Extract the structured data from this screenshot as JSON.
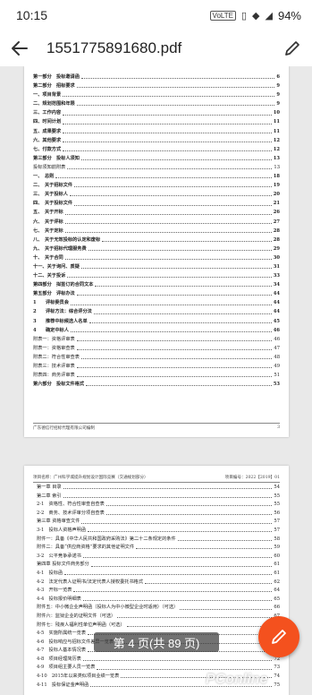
{
  "status": {
    "time": "10:15",
    "network": "VoLTE",
    "battery": "94%"
  },
  "appbar": {
    "title": "1551775891680.pdf"
  },
  "page1": {
    "toc": [
      {
        "t": "第一部分　投标邀请函",
        "p": "6",
        "bold": true
      },
      {
        "t": "第二部分　招标要求",
        "p": "9",
        "bold": true
      },
      {
        "t": "一、项目背景",
        "p": "9",
        "bold": true
      },
      {
        "t": "二、规划范围和年限",
        "p": "9",
        "bold": true
      },
      {
        "t": "三、工作内容",
        "p": "10",
        "bold": true
      },
      {
        "t": "四、时间计划",
        "p": "11",
        "bold": true
      },
      {
        "t": "五、成果要求",
        "p": "11",
        "bold": true
      },
      {
        "t": "六、其他要求",
        "p": "12",
        "bold": true
      },
      {
        "t": "七、付款方式",
        "p": "12",
        "bold": true
      },
      {
        "t": "第三部分　投标人须知",
        "p": "13",
        "bold": true
      },
      {
        "t": "投标须知前附表",
        "p": "13",
        "bold": false
      },
      {
        "t": "一、　总则",
        "p": "18",
        "bold": true
      },
      {
        "t": "二、　关于招标文件",
        "p": "19",
        "bold": true
      },
      {
        "t": "三、　关于投标人",
        "p": "20",
        "bold": true
      },
      {
        "t": "四、　关于投标文件",
        "p": "21",
        "bold": true
      },
      {
        "t": "五、　关于开标",
        "p": "26",
        "bold": true
      },
      {
        "t": "六、　关于评标",
        "p": "27",
        "bold": true
      },
      {
        "t": "七、　关于定标",
        "p": "28",
        "bold": true
      },
      {
        "t": "八、　关于无效投标的认定和废标",
        "p": "28",
        "bold": true
      },
      {
        "t": "九、　关于招标代理服务费",
        "p": "29",
        "bold": true
      },
      {
        "t": "十、　关于合同",
        "p": "30",
        "bold": true
      },
      {
        "t": "十一、关于询问、质疑",
        "p": "31",
        "bold": true
      },
      {
        "t": "十二、关于投诉",
        "p": "33",
        "bold": true
      },
      {
        "t": "第四部分　拟签订的合同文本",
        "p": "34",
        "bold": true
      },
      {
        "t": "第五部分　评标办法",
        "p": "44",
        "bold": true
      },
      {
        "t": "1　　评标委员会",
        "p": "44",
        "bold": true
      },
      {
        "t": "2　　评标方法：综合评分法",
        "p": "44",
        "bold": true
      },
      {
        "t": "3　　推荐中标候选人名单",
        "p": "45",
        "bold": true
      },
      {
        "t": "4　　确定中标人",
        "p": "46",
        "bold": true
      },
      {
        "t": "附表一：资格评审表",
        "p": "46",
        "bold": false
      },
      {
        "t": "附表一：资格审查表",
        "p": "47",
        "bold": false
      },
      {
        "t": "附表二：符合性审查表",
        "p": "48",
        "bold": false
      },
      {
        "t": "附表三：技术评审表",
        "p": "49",
        "bold": false
      },
      {
        "t": "附表四：商务评审表",
        "p": "51",
        "bold": false
      },
      {
        "t": "第六部分　投标文件格式",
        "p": "53",
        "bold": true
      }
    ],
    "footer_left": "广东德信行招标代理有限公司编制",
    "footer_right": "3"
  },
  "page2": {
    "header_left": "项目名称：广州科学城提升规划设计国际竞赛（交通规划部分）",
    "header_right": "项目编号：2022【2019】01",
    "toc": [
      {
        "t": "第一章 目录",
        "p": "54"
      },
      {
        "t": "第二章 索引",
        "p": "55"
      },
      {
        "t": "2-1　资格性、符合性审查自查表",
        "p": "55"
      },
      {
        "t": "2-2　商务、技术评审分项自查表",
        "p": "56"
      },
      {
        "t": "第三章 资格审查文件",
        "p": "57"
      },
      {
        "t": "3-1　投标人资格声明函",
        "p": "57"
      },
      {
        "t": "附件一：具备《中华人民共和国政府采购法》第二十二条规定的条件",
        "p": "58"
      },
      {
        "t": "附件二：具备“供应商资格”要求的其他证明文件",
        "p": "59"
      },
      {
        "t": "3-2　公平竞争承诺书",
        "p": "60"
      },
      {
        "t": "第四章 投标文件商务部分",
        "p": "61"
      },
      {
        "t": "4-1　投标函",
        "p": "61"
      },
      {
        "t": "4-2　法定代表人证明书/法定代表人授权委托书格式",
        "p": "62"
      },
      {
        "t": "4-3　开标一览表",
        "p": "64"
      },
      {
        "t": "4-4　投标报价明细表",
        "p": "65"
      },
      {
        "t": "附件五：中小微企业声明函（投标人为中小微型企业时适用）（可选）",
        "p": "66"
      },
      {
        "t": "附件六：监狱企业的证明文件（可选）",
        "p": "67"
      },
      {
        "t": "附件七：残疾人福利性单位声明函（可选）",
        "p": "68"
      },
      {
        "t": "4-5　实施所属统一览表",
        "p": "69"
      },
      {
        "t": "4-6　投标响应与招标文件差异一览表",
        "p": "70"
      },
      {
        "t": "4-7　投标人基本情况表",
        "p": "71"
      },
      {
        "t": "4-8　项目经理简历表",
        "p": "72"
      },
      {
        "t": "4-9　项目组主要人员一览表",
        "p": "73"
      },
      {
        "t": "4-10　2015年以来类似项目业绩一览表",
        "p": "74"
      },
      {
        "t": "4-11　投标保证金声明函",
        "p": "75"
      }
    ]
  },
  "page_indicator": "第 4 页(共 89 页)",
  "watermark": "PConline",
  "colors": {
    "fab": "#f4511e",
    "background": "#e9e9e9"
  }
}
